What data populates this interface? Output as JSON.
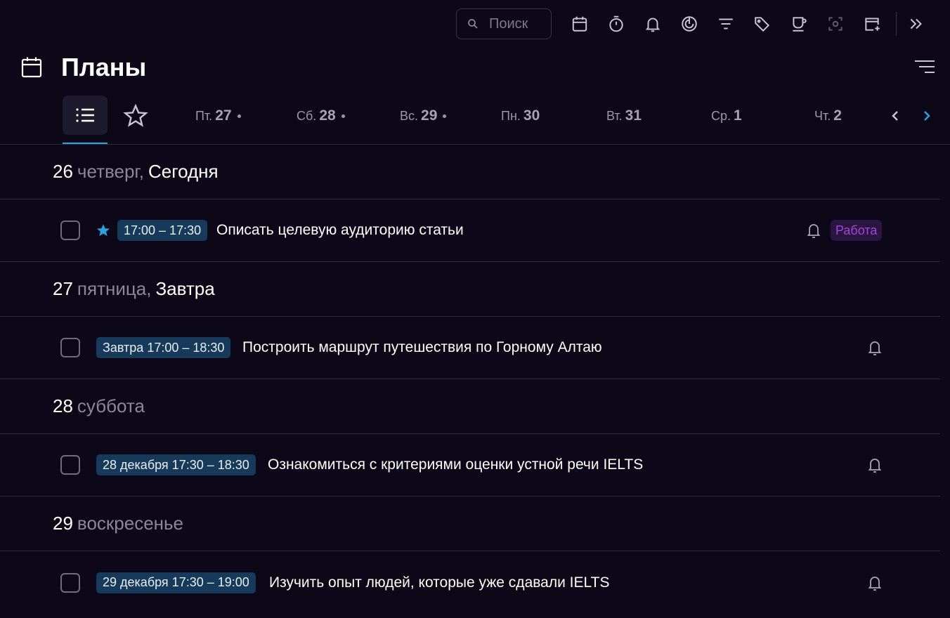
{
  "toolbar": {
    "search_placeholder": "Поиск",
    "icons": [
      "calendar-icon",
      "timer-icon",
      "bell-icon",
      "focus-icon",
      "filter-icon",
      "tag-icon",
      "coffee-icon",
      "scan-icon",
      "add-calendar-icon",
      "collapse-icon"
    ]
  },
  "header": {
    "title": "Планы"
  },
  "tabs": {
    "days": [
      {
        "weekday": "Пт.",
        "day": "27",
        "has_dot": true
      },
      {
        "weekday": "Сб.",
        "day": "28",
        "has_dot": true
      },
      {
        "weekday": "Вс.",
        "day": "29",
        "has_dot": true
      },
      {
        "weekday": "Пн.",
        "day": "30",
        "has_dot": false
      },
      {
        "weekday": "Вт.",
        "day": "31",
        "has_dot": false
      },
      {
        "weekday": "Ср.",
        "day": "1",
        "has_dot": false
      },
      {
        "weekday": "Чт.",
        "day": "2",
        "has_dot": false
      }
    ]
  },
  "sections": [
    {
      "num": "26",
      "weekday": "четверг,",
      "relative": "Сегодня",
      "task": {
        "starred": true,
        "time": "17:00 – 17:30",
        "title": "Описать целевую аудиторию статьи",
        "tag": "Работа"
      }
    },
    {
      "num": "27",
      "weekday": "пятница,",
      "relative": "Завтра",
      "task": {
        "starred": false,
        "time": "Завтра 17:00 – 18:30",
        "title": "Построить маршрут путешествия по Горному Алтаю",
        "tag": ""
      }
    },
    {
      "num": "28",
      "weekday": "суббота",
      "relative": "",
      "task": {
        "starred": false,
        "time": "28 декабря 17:30 – 18:30",
        "title": "Ознакомиться с критериями оценки устной речи IELTS",
        "tag": ""
      }
    },
    {
      "num": "29",
      "weekday": "воскресенье",
      "relative": "",
      "task": {
        "starred": false,
        "time": "29 декабря 17:30 – 19:00",
        "title": "Изучить опыт людей, которые уже сдавали IELTS",
        "tag": ""
      }
    }
  ],
  "colors": {
    "background": "#0d0818",
    "accent": "#2aa2e0",
    "time_badge": "#173a5a",
    "tag_text": "#a245d6",
    "tag_bg": "#2a1640"
  }
}
